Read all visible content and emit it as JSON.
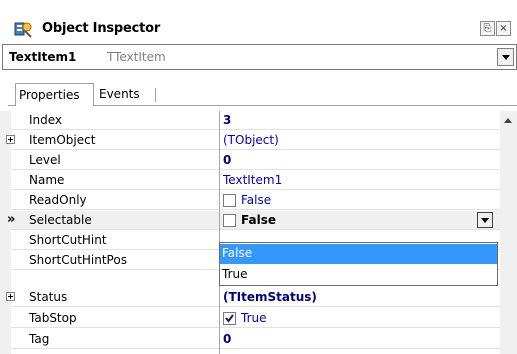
{
  "window": {
    "title": "Object Inspector",
    "pin_glyph": "⎘",
    "close_glyph": "×",
    "icon": "object-inspector-icon"
  },
  "component": {
    "name": "TextItem1",
    "type": "TTextItem"
  },
  "tabs": [
    {
      "label": "Properties",
      "active": true
    },
    {
      "label": "Events",
      "active": false
    }
  ],
  "properties": [
    {
      "name": "Index",
      "value": "3",
      "style": "bold"
    },
    {
      "name": "ItemObject",
      "value": "(TObject)",
      "style": "blue",
      "expandable": true
    },
    {
      "name": "Level",
      "value": "0",
      "style": "bold"
    },
    {
      "name": "Name",
      "value": "TextItem1",
      "style": "blue"
    },
    {
      "name": "ReadOnly",
      "value": "False",
      "style": "checkbox",
      "checked": false
    },
    {
      "name": "Selectable",
      "value": "False",
      "style": "checkbox-bold",
      "checked": false,
      "selected": true,
      "marker": "»"
    },
    {
      "name": "ShortCutHint",
      "value": ""
    },
    {
      "name": "ShortCutHintPos",
      "value": ""
    },
    {
      "name": "Status",
      "value": "(TItemStatus)",
      "style": "bold",
      "expandable": true
    },
    {
      "name": "TabStop",
      "value": "True",
      "style": "checkbox",
      "checked": true
    },
    {
      "name": "Tag",
      "value": "0",
      "style": "bold"
    }
  ],
  "dropdown": {
    "options": [
      "False",
      "True"
    ],
    "selected": "False"
  },
  "colors": {
    "value_blue": "#0000c8",
    "value_navy": "#000080",
    "highlight": "#3399ff"
  }
}
